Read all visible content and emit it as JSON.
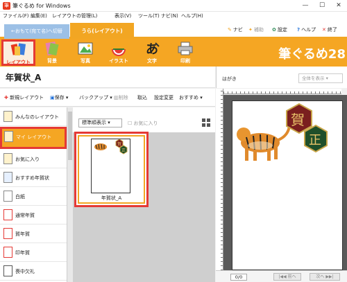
{
  "window": {
    "title": "筆ぐるめ for Windows",
    "app_icon_glyph": "筆",
    "minimize": "—",
    "maximize": "☐",
    "close": "✕"
  },
  "menu": {
    "items": [
      "ファイル(F)",
      "編集(E)",
      "レイアウトの管理(L)",
      "表示(V)",
      "ツール(T)",
      "ナビ(N)",
      "ヘルプ(H)"
    ]
  },
  "tabs": {
    "omote": "←おもて(宛て名)へ切替",
    "ura": "うら(レイアウト)"
  },
  "tab_tools": {
    "navi": "ナビ",
    "hojo": "補助",
    "settei": "設定",
    "help": "ヘルプ",
    "shuryo": "終了"
  },
  "ribbon": {
    "items": [
      {
        "label": "レイアウト",
        "icon": "layout-icon"
      },
      {
        "label": "背景",
        "icon": "background-icon"
      },
      {
        "label": "写真",
        "icon": "photo-icon"
      },
      {
        "label": "イラスト",
        "icon": "illustration-icon"
      },
      {
        "label": "文字",
        "icon": "text-icon"
      },
      {
        "label": "印刷",
        "icon": "print-icon"
      }
    ],
    "brand": "筆ぐるめ28"
  },
  "layout_panel": {
    "title": "年賀状_A"
  },
  "toolbar": {
    "new_layout": "新規レイアウト",
    "save": "保存",
    "backup": "バックアップ",
    "delete": "削除",
    "import": "取込",
    "change_settings": "設定変更",
    "recommend": "おすすめ"
  },
  "categories": [
    "みんなのレイアウト",
    "マイ レイアウト",
    "お気に入り",
    "おすすめ年賀状",
    "白紙",
    "通常年賀",
    "賀年賀",
    "印年賀",
    "喪中欠礼"
  ],
  "thumbnails": {
    "sort": "標準順表示",
    "favorites_filter": "お気に入り",
    "items": [
      {
        "name": "年賀状_A"
      }
    ]
  },
  "preview": {
    "label": "はがき",
    "zoom": "全体を表示",
    "page": "0/0",
    "prev": "|◀◀ 前へ",
    "next": "次へ ▶▶|",
    "kanji_1": "賀",
    "kanji_2": "正"
  },
  "colors": {
    "accent_orange": "#f5a623",
    "highlight_red": "#e53935",
    "tab_blue": "#9cc0e6"
  }
}
